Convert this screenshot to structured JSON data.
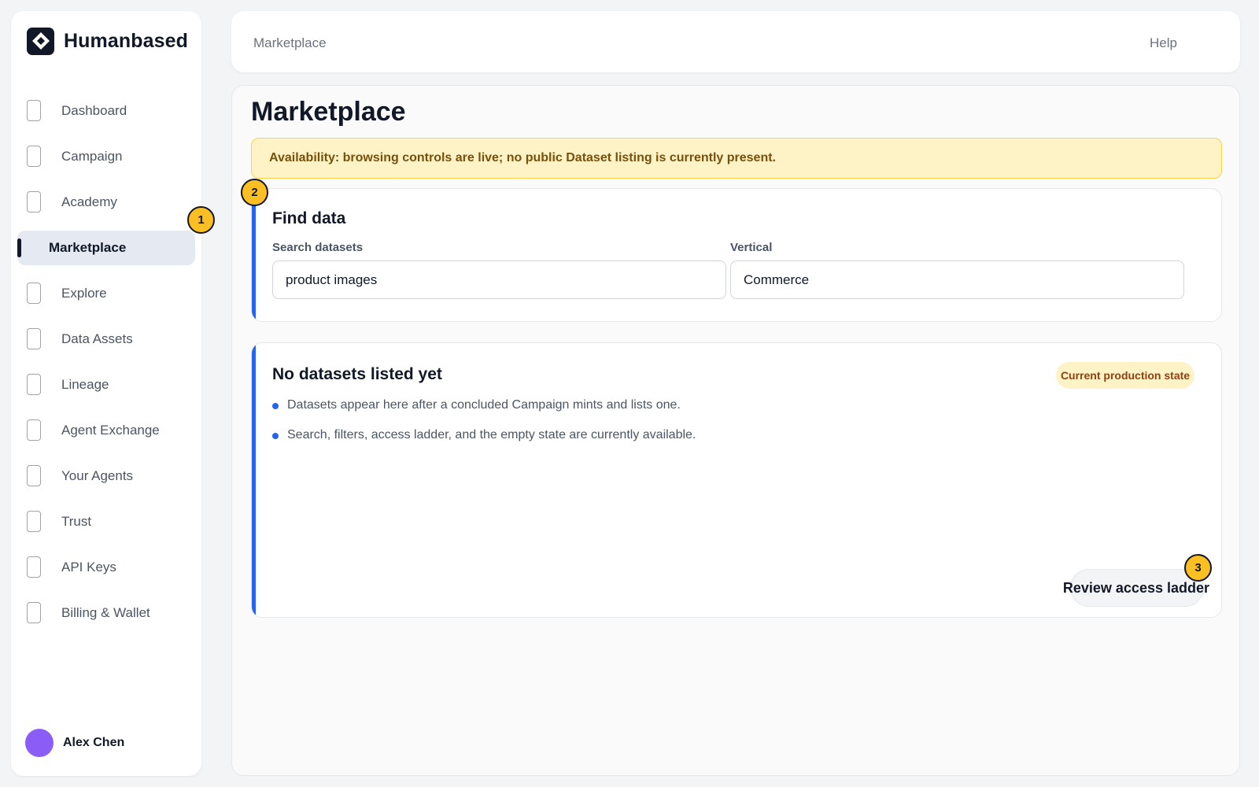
{
  "brand": {
    "name": "Humanbased",
    "logo_icon": "diamond-logo-icon"
  },
  "sidebar": {
    "items": [
      {
        "label": "Dashboard",
        "icon": "page-icon",
        "active": false
      },
      {
        "label": "Campaign",
        "icon": "page-icon",
        "active": false
      },
      {
        "label": "Academy",
        "icon": "page-icon",
        "active": false
      },
      {
        "label": "Marketplace",
        "icon": "",
        "active": true
      },
      {
        "label": "Explore",
        "icon": "page-icon",
        "active": false
      },
      {
        "label": "Data Assets",
        "icon": "page-icon",
        "active": false
      },
      {
        "label": "Lineage",
        "icon": "page-icon",
        "active": false
      },
      {
        "label": "Agent Exchange",
        "icon": "page-icon",
        "active": false
      },
      {
        "label": "Your Agents",
        "icon": "page-icon",
        "active": false
      },
      {
        "label": "Trust",
        "icon": "page-icon",
        "active": false
      },
      {
        "label": "API Keys",
        "icon": "page-icon",
        "active": false
      },
      {
        "label": "Billing & Wallet",
        "icon": "page-icon",
        "active": false
      }
    ]
  },
  "user": {
    "name": "Alex Chen",
    "avatar_color": "#8b5cf6"
  },
  "topbar": {
    "breadcrumb": "Marketplace",
    "help_label": "Help"
  },
  "main": {
    "title": "Marketplace",
    "alert": "Availability: browsing controls are live; no public Dataset listing is currently present.",
    "find": {
      "title": "Find data",
      "search_label": "Search datasets",
      "search_value": "product images",
      "vertical_label": "Vertical",
      "vertical_value": "Commerce"
    },
    "empty": {
      "title": "No datasets listed yet",
      "badge": "Current production state",
      "bullets": [
        "Datasets appear here after a concluded Campaign mints and lists one.",
        "Search, filters, access ladder, and the empty state are currently available."
      ],
      "button_label": "Review access ladder"
    }
  },
  "markers": [
    "1",
    "2",
    "3"
  ],
  "colors": {
    "accent": "#2563eb",
    "alert_bg": "#fef3c7",
    "marker": "#fbbf24"
  }
}
